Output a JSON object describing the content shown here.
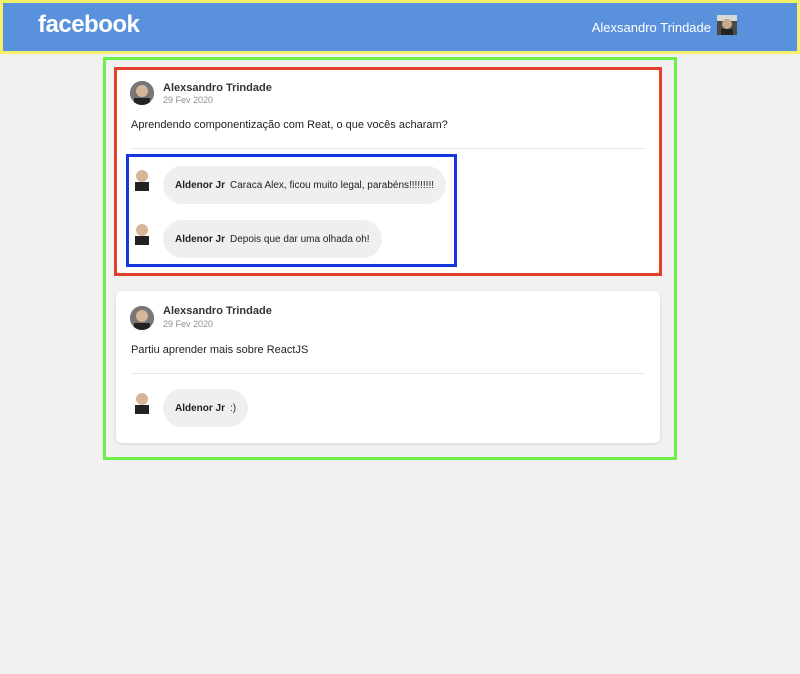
{
  "header": {
    "logo": "facebook",
    "user_name": "Alexsandro Trindade"
  },
  "posts": [
    {
      "author": "Alexsandro Trindade",
      "date": "29 Fev 2020",
      "content": "Aprendendo componentização com Reat, o que vocês acharam?",
      "comments": [
        {
          "author": "Aldenor Jr",
          "text": "Caraca Alex, ficou muito legal, parabéns!!!!!!!!!"
        },
        {
          "author": "Aldenor Jr",
          "text": "Depois que dar uma olhada oh!"
        }
      ]
    },
    {
      "author": "Alexsandro Trindade",
      "date": "29 Fev 2020",
      "content": "Partiu aprender mais sobre ReactJS",
      "comments": [
        {
          "author": "Aldenor Jr",
          "text": ":)"
        }
      ]
    }
  ],
  "colors": {
    "header_bg": "#5a91dc",
    "outline_header": "#f3f06a",
    "outline_feed": "#6bf04c",
    "outline_post": "#e2402a",
    "outline_comments": "#1636e0"
  }
}
